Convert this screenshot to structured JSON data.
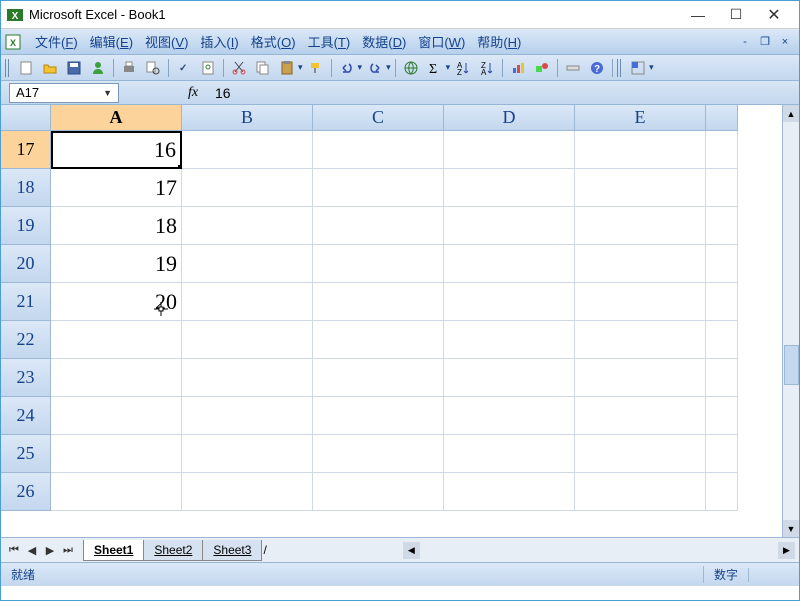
{
  "window": {
    "title": "Microsoft Excel - Book1"
  },
  "menu": {
    "items": [
      {
        "label": "文件",
        "key": "F"
      },
      {
        "label": "编辑",
        "key": "E"
      },
      {
        "label": "视图",
        "key": "V"
      },
      {
        "label": "插入",
        "key": "I"
      },
      {
        "label": "格式",
        "key": "O"
      },
      {
        "label": "工具",
        "key": "T"
      },
      {
        "label": "数据",
        "key": "D"
      },
      {
        "label": "窗口",
        "key": "W"
      },
      {
        "label": "帮助",
        "key": "H"
      }
    ]
  },
  "namebox": {
    "ref": "A17",
    "formula": "16"
  },
  "columns": [
    "A",
    "B",
    "C",
    "D",
    "E",
    ""
  ],
  "rows": [
    {
      "num": "17",
      "cells": [
        "16",
        "",
        "",
        "",
        "",
        ""
      ],
      "selected": true
    },
    {
      "num": "18",
      "cells": [
        "17",
        "",
        "",
        "",
        "",
        ""
      ]
    },
    {
      "num": "19",
      "cells": [
        "18",
        "",
        "",
        "",
        "",
        ""
      ]
    },
    {
      "num": "20",
      "cells": [
        "19",
        "",
        "",
        "",
        "",
        ""
      ]
    },
    {
      "num": "21",
      "cells": [
        "20",
        "",
        "",
        "",
        "",
        ""
      ]
    },
    {
      "num": "22",
      "cells": [
        "",
        "",
        "",
        "",
        "",
        ""
      ]
    },
    {
      "num": "23",
      "cells": [
        "",
        "",
        "",
        "",
        "",
        ""
      ]
    },
    {
      "num": "24",
      "cells": [
        "",
        "",
        "",
        "",
        "",
        ""
      ]
    },
    {
      "num": "25",
      "cells": [
        "",
        "",
        "",
        "",
        "",
        ""
      ]
    },
    {
      "num": "26",
      "cells": [
        "",
        "",
        "",
        "",
        "",
        ""
      ]
    }
  ],
  "tabs": [
    "Sheet1",
    "Sheet2",
    "Sheet3"
  ],
  "active_tab": 0,
  "status": {
    "ready": "就绪",
    "numlock": "数字"
  }
}
